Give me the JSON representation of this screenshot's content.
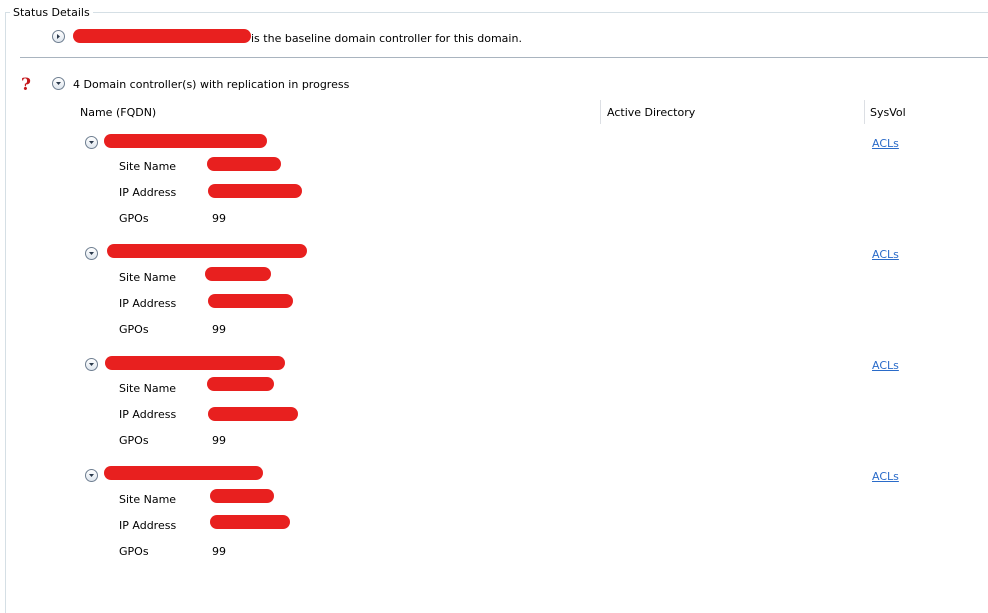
{
  "section_title": "Status Details",
  "baseline_text": "is the baseline domain controller for this domain.",
  "group_header": "4 Domain controller(s) with replication in progress",
  "columns": [
    "Name (FQDN)",
    "Active Directory",
    "SysVol"
  ],
  "controllers": [
    {
      "site_label": "Site Name",
      "ip_label": "IP Address",
      "gpo_label": "GPOs",
      "gpo_value": "99",
      "sysvol_link": "ACLs"
    },
    {
      "site_label": "Site Name",
      "ip_label": "IP Address",
      "gpo_label": "GPOs",
      "gpo_value": "99",
      "sysvol_link": "ACLs"
    },
    {
      "site_label": "Site Name",
      "ip_label": "IP Address",
      "gpo_label": "GPOs",
      "gpo_value": "99",
      "sysvol_link": "ACLs"
    },
    {
      "site_label": "Site Name",
      "ip_label": "IP Address",
      "gpo_label": "GPOs",
      "gpo_value": "99",
      "sysvol_link": "ACLs"
    }
  ],
  "colors": {
    "redaction": "#e8201f",
    "link": "#2a6bc9",
    "warning": "#c4171b"
  },
  "icons": {
    "expand": "expand-right-icon",
    "collapse": "collapse-down-icon",
    "warning": "question-mark-icon"
  }
}
